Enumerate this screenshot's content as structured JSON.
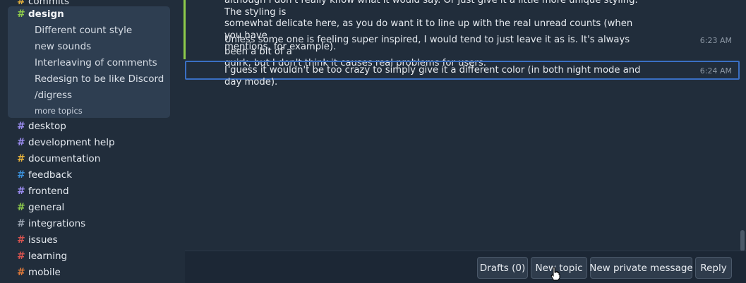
{
  "sidebar": {
    "streams_top": [
      {
        "name": "commits",
        "color": "#e6b23c"
      }
    ],
    "active_stream": {
      "name": "design",
      "color": "#8ecb4b"
    },
    "topics": [
      {
        "label": "Different count style"
      },
      {
        "label": "new sounds"
      },
      {
        "label": "Interleaving of comments"
      },
      {
        "label": "Redesign to be like Discord"
      },
      {
        "label": "/digress"
      }
    ],
    "more_topics": "more topics",
    "streams": [
      {
        "name": "desktop",
        "color": "#9b8cf0"
      },
      {
        "name": "development help",
        "color": "#9b8cf0"
      },
      {
        "name": "documentation",
        "color": "#e6b23c"
      },
      {
        "name": "feedback",
        "color": "#3b8fd8"
      },
      {
        "name": "frontend",
        "color": "#9b8cf0"
      },
      {
        "name": "general",
        "color": "#8ecb4b"
      },
      {
        "name": "integrations",
        "color": "#9aa4b1"
      },
      {
        "name": "issues",
        "color": "#d8534f"
      },
      {
        "name": "learning",
        "color": "#d8534f"
      },
      {
        "name": "mobile",
        "color": "#e07a3a"
      }
    ]
  },
  "messages": [
    {
      "lines": [
        "although I don't really know what it would say. Or just give it a little more unique styling. The styling is",
        "somewhat delicate here, as you do want it to line up with the real unread counts (when you have",
        "mentions, for example)."
      ],
      "time": ""
    },
    {
      "lines": [
        "Unless some one is feeling super inspired, I would tend to just leave it as is. It's always been a bit of a",
        "quirk, but I don't think it causes real problems for users."
      ],
      "time": "6:23 AM"
    },
    {
      "lines": [
        "I guess it wouldn't be too crazy to simply give it a different color (in both night mode and day mode)."
      ],
      "time": "6:24 AM"
    }
  ],
  "compose": {
    "drafts": "Drafts (0)",
    "new_topic": "New topic",
    "new_private_message": "New private message",
    "reply": "Reply"
  }
}
